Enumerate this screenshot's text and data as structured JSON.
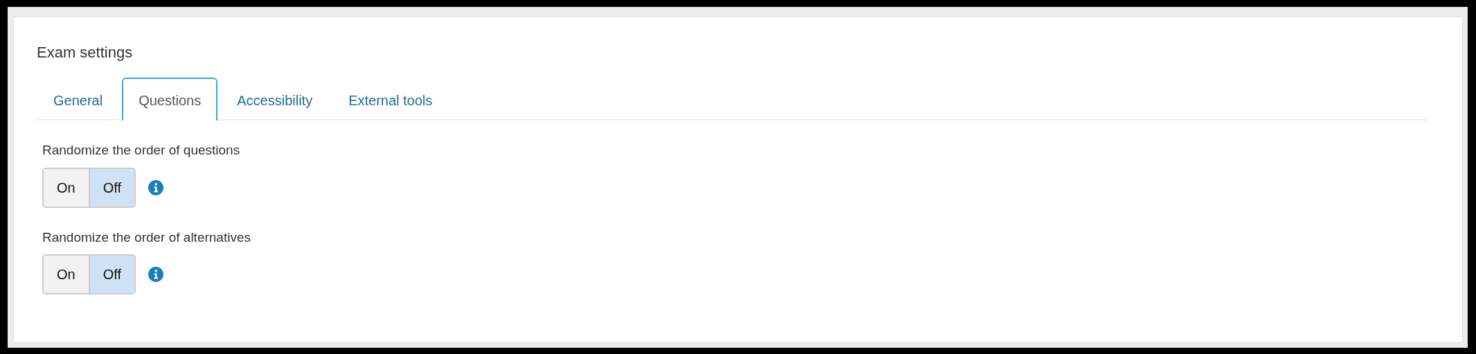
{
  "panel": {
    "title": "Exam settings"
  },
  "tabs": [
    {
      "label": "General",
      "selected": false
    },
    {
      "label": "Questions",
      "selected": true
    },
    {
      "label": "Accessibility",
      "selected": false
    },
    {
      "label": "External tools",
      "selected": false
    }
  ],
  "settings": [
    {
      "label": "Randomize the order of questions",
      "options": [
        {
          "label": "On",
          "selected": false
        },
        {
          "label": "Off",
          "selected": true
        }
      ]
    },
    {
      "label": "Randomize the order of alternatives",
      "options": [
        {
          "label": "On",
          "selected": false
        },
        {
          "label": "Off",
          "selected": true
        }
      ]
    }
  ]
}
